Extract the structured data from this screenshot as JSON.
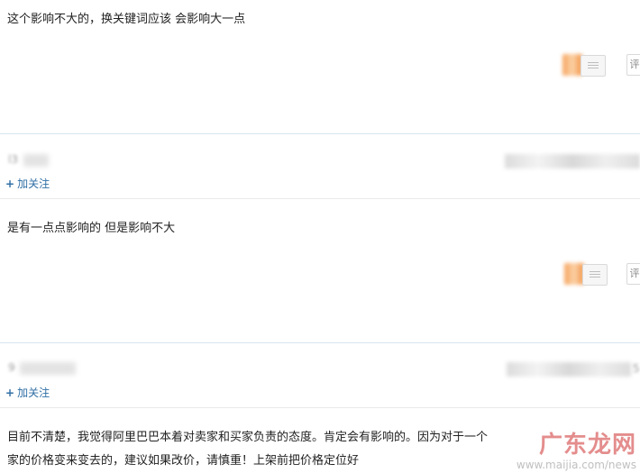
{
  "answers": [
    {
      "text": "这个影响不大的，换关键词应该 会影响大一点",
      "side_button_label": "评"
    },
    {
      "user": {
        "name": "l3",
        "follow_label": "加关注"
      },
      "text": "是有一点点影响的  但是影响不大",
      "side_button_label": "评"
    },
    {
      "user": {
        "name": "9",
        "date_tail": "5",
        "follow_label": "加关注"
      },
      "text_lines": [
        "目前不清楚，我觉得阿里巴巴本着对卖家和买家负责的态度。肯定会有影响的。因为对于一个",
        "家的价格变来变去的，建议如果改价，请慎重！上架前把价格定位好"
      ]
    }
  ],
  "watermark": {
    "logo_text": "广东龙网",
    "url_text": "www.maijia.com/news"
  },
  "colors": {
    "link": "#2f6fa5",
    "divider": "#d6e6ee",
    "vote_orange": "#f7a35c"
  }
}
